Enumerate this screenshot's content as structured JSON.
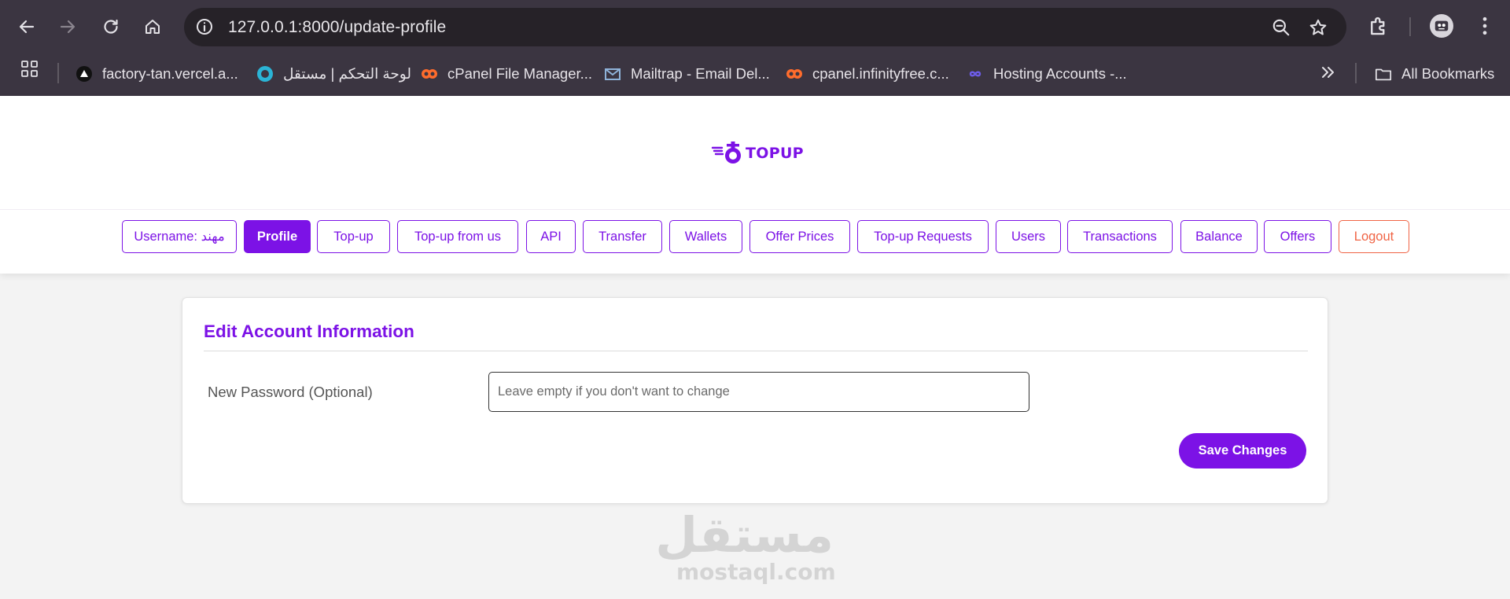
{
  "browser": {
    "url": "127.0.0.1:8000/update-profile",
    "bookmarks": [
      {
        "label": "factory-tan.vercel.a...",
        "icon": "vercel-icon"
      },
      {
        "label": "لوحة التحكم | مستقل",
        "icon": "mostaql-icon"
      },
      {
        "label": "cPanel File Manager...",
        "icon": "cpanel-icon"
      },
      {
        "label": "Mailtrap - Email Del...",
        "icon": "mailtrap-icon"
      },
      {
        "label": "cpanel.infinityfree.c...",
        "icon": "cpanel-icon"
      },
      {
        "label": "Hosting Accounts -...",
        "icon": "infinity-icon"
      }
    ],
    "all_bookmarks": "All Bookmarks"
  },
  "site": {
    "logo_text": "TOPUP",
    "nav": [
      {
        "label": "Username: مهند",
        "key": "username"
      },
      {
        "label": "Profile",
        "key": "profile",
        "active": true
      },
      {
        "label": "Top-up",
        "key": "topup"
      },
      {
        "label": "Top-up from us",
        "key": "topup-from-us"
      },
      {
        "label": "API",
        "key": "api"
      },
      {
        "label": "Transfer",
        "key": "transfer"
      },
      {
        "label": "Wallets",
        "key": "wallets"
      },
      {
        "label": "Offer Prices",
        "key": "offer-prices"
      },
      {
        "label": "Top-up Requests",
        "key": "topup-requests"
      },
      {
        "label": "Users",
        "key": "users"
      },
      {
        "label": "Transactions",
        "key": "transactions"
      },
      {
        "label": "Balance",
        "key": "balance"
      },
      {
        "label": "Offers",
        "key": "offers"
      },
      {
        "label": "Logout",
        "key": "logout"
      }
    ]
  },
  "form": {
    "title": "Edit Account Information",
    "password_label": "New Password (Optional)",
    "password_value": "",
    "password_placeholder": "Leave empty if you don't want to change",
    "save_label": "Save Changes"
  },
  "watermark": {
    "arabic": "مستقل",
    "latin": "mostaql.com"
  },
  "colors": {
    "accent": "#7c12e6",
    "logout": "#f06445",
    "chrome": "#3b3541"
  }
}
